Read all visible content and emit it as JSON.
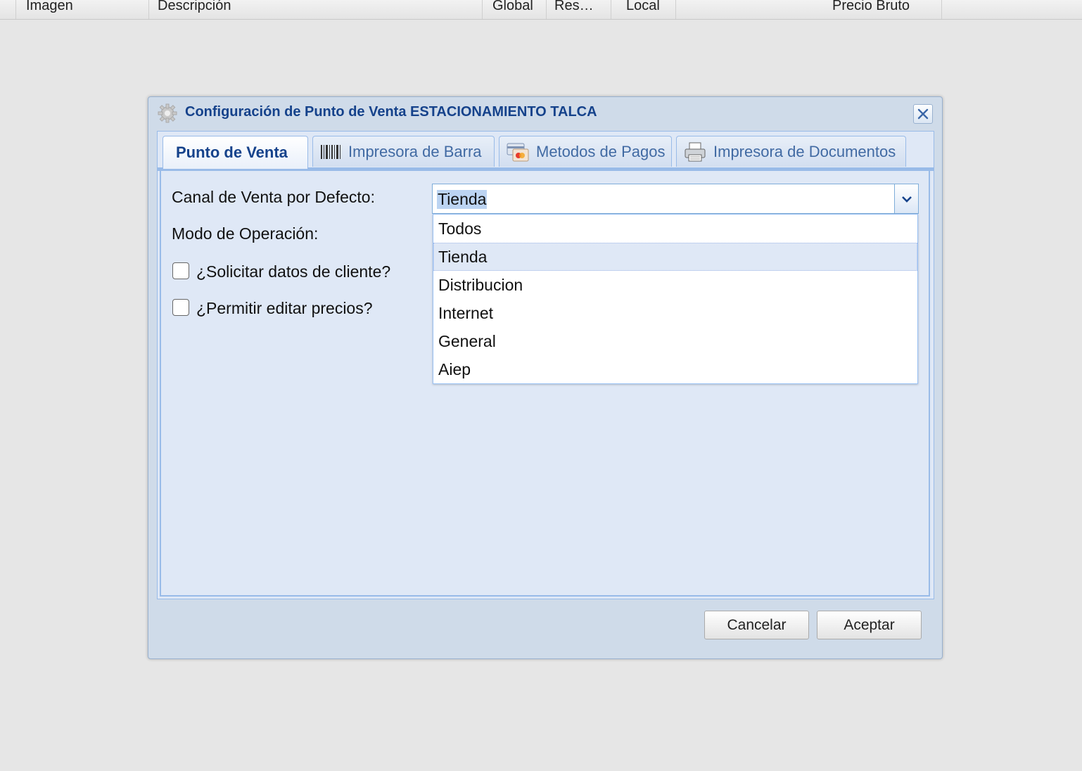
{
  "grid": {
    "columns": [
      "Imagen",
      "Descripción",
      "Global",
      "Res…",
      "Local",
      "Precio Bruto"
    ]
  },
  "window": {
    "title": "Configuración de Punto de Venta ESTACIONAMIENTO TALCA",
    "icon": "gear-icon",
    "close_icon": "close-icon"
  },
  "tabs": [
    {
      "label": "Punto de Venta",
      "icon": null,
      "active": true
    },
    {
      "label": "Impresora de Barra",
      "icon": "barcode-icon",
      "active": false
    },
    {
      "label": "Metodos de Pagos",
      "icon": "payment-card-icon",
      "active": false
    },
    {
      "label": "Impresora de Documentos",
      "icon": "printer-icon",
      "active": false
    }
  ],
  "form": {
    "canal_label": "Canal de Venta por Defecto:",
    "canal_value": "Tienda",
    "modo_label": "Modo de Operación:",
    "solicitar_label": "¿Solicitar datos de cliente?",
    "solicitar_checked": false,
    "permitir_label": "¿Permitir editar precios?",
    "permitir_checked": false
  },
  "dropdown": {
    "options": [
      "Todos",
      "Tienda",
      "Distribucion",
      "Internet",
      "General",
      "Aiep"
    ],
    "selected_index": 1
  },
  "buttons": {
    "cancel": "Cancelar",
    "accept": "Aceptar"
  },
  "colors": {
    "title_text": "#15428b",
    "tab_border": "#99bbe8",
    "panel_bg": "#dfe8f6",
    "window_bg": "#cfdbe9"
  }
}
